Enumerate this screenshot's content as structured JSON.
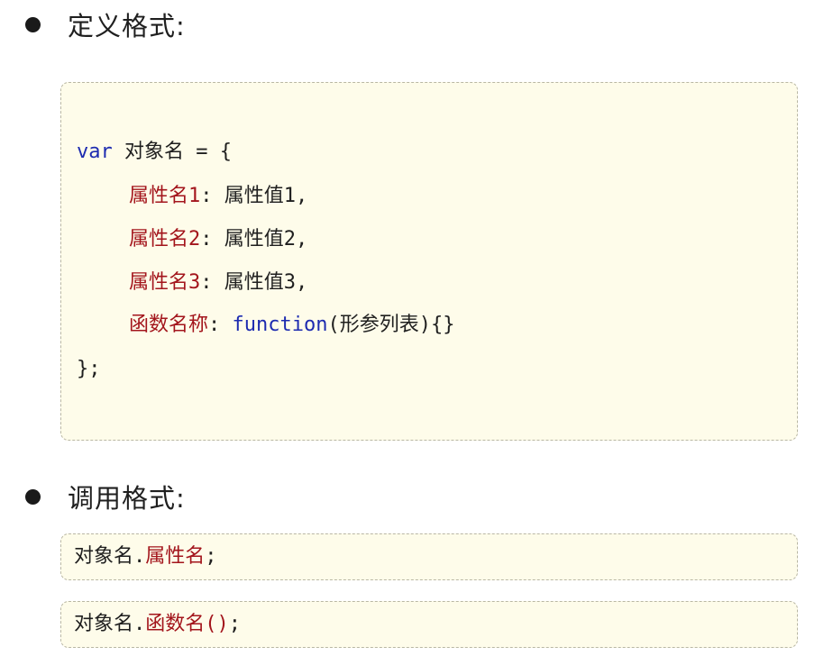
{
  "section_define": {
    "title": "定义格式:",
    "code": {
      "line1_kw": "var",
      "line1_rest": " 对象名 = {",
      "line2_prop": "属性名1",
      "line2_rest": ": 属性值1,",
      "line3_prop": "属性名2",
      "line3_rest": ": 属性值2,",
      "line4_prop": "属性名3",
      "line4_rest": ": 属性值3,",
      "line5_prop": "函数名称",
      "line5_sep": ": ",
      "line5_kw": "function",
      "line5_rest": "(形参列表){}",
      "line6": "};"
    }
  },
  "section_call": {
    "title": "调用格式:",
    "prop_call": {
      "object": "对象名.",
      "member": "属性名",
      "end": ";"
    },
    "method_call": {
      "object": "对象名.",
      "member": "函数名()",
      "end": ";"
    }
  },
  "colors": {
    "keyword": "#1d2bb0",
    "property": "#a3151c",
    "code_background": "#fefcea"
  }
}
